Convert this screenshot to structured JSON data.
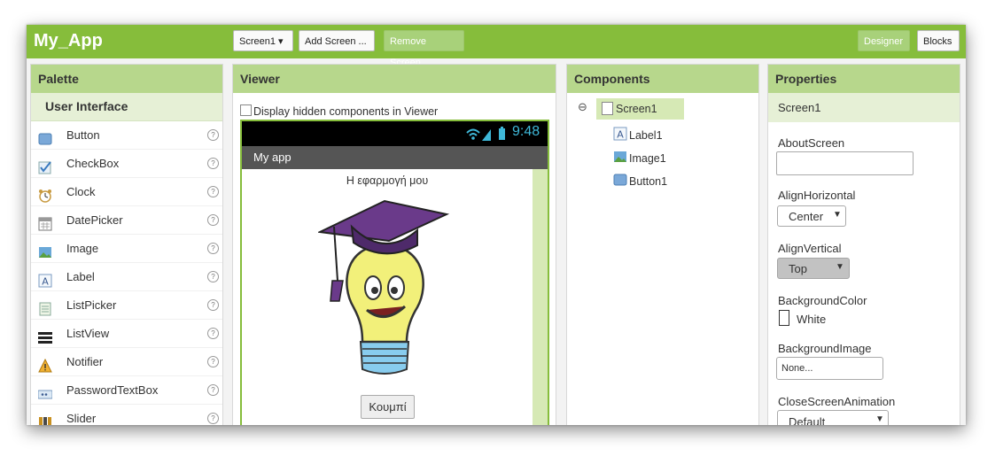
{
  "app": {
    "title": "My_App"
  },
  "toolbar": {
    "screen_select": "Screen1 ▾",
    "add_screen": "Add Screen ...",
    "remove_screen": "Remove Screen",
    "designer": "Designer",
    "blocks": "Blocks"
  },
  "palette": {
    "title": "Palette",
    "category": "User Interface",
    "items": [
      {
        "label": "Button",
        "icon": "button-icon"
      },
      {
        "label": "CheckBox",
        "icon": "checkbox-icon"
      },
      {
        "label": "Clock",
        "icon": "clock-icon"
      },
      {
        "label": "DatePicker",
        "icon": "datepicker-icon"
      },
      {
        "label": "Image",
        "icon": "image-icon"
      },
      {
        "label": "Label",
        "icon": "label-icon"
      },
      {
        "label": "ListPicker",
        "icon": "listpicker-icon"
      },
      {
        "label": "ListView",
        "icon": "listview-icon"
      },
      {
        "label": "Notifier",
        "icon": "notifier-icon"
      },
      {
        "label": "PasswordTextBox",
        "icon": "passwordtextbox-icon"
      },
      {
        "label": "Slider",
        "icon": "slider-icon"
      }
    ],
    "help_glyph": "?"
  },
  "viewer": {
    "title": "Viewer",
    "hidden_toggle_label": "Display hidden components in Viewer",
    "status_time": "9:48",
    "app_bar_title": "My app",
    "label_text": "Η εφαρμογή μου",
    "button_text": "Κουμπί"
  },
  "components": {
    "title": "Components",
    "collapse_glyph": "⊖",
    "tree": [
      {
        "label": "Screen1"
      },
      {
        "label": "Label1"
      },
      {
        "label": "Image1"
      },
      {
        "label": "Button1"
      }
    ]
  },
  "properties": {
    "title": "Properties",
    "selected": "Screen1",
    "about_label": "AboutScreen",
    "about_value": "",
    "align_h_label": "AlignHorizontal",
    "align_h_value": "Center",
    "align_v_label": "AlignVertical",
    "align_v_value": "Top",
    "bg_color_label": "BackgroundColor",
    "bg_color_value": "White",
    "bg_image_label": "BackgroundImage",
    "bg_image_value": "None...",
    "close_anim_label": "CloseScreenAnimation",
    "close_anim_value": "Default"
  },
  "colors": {
    "brand": "#86bd3b",
    "header": "#b7d78c",
    "sub": "#e6f0d6"
  }
}
